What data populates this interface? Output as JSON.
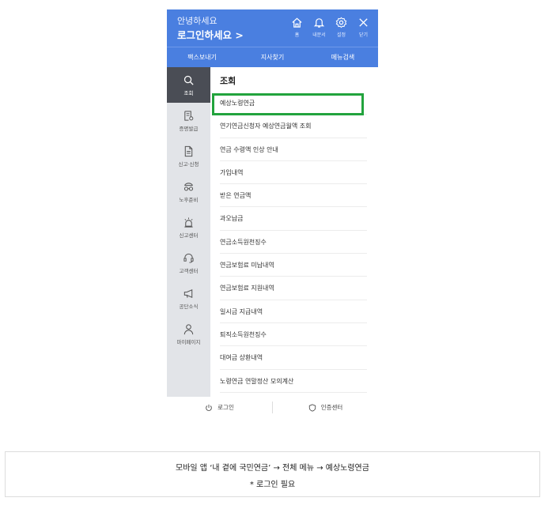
{
  "header": {
    "greeting": "안녕하세요",
    "login_link": "로그인하세요 >",
    "icons": [
      {
        "icon": "home-icon",
        "label": "홈"
      },
      {
        "icon": "bell-icon",
        "label": "내문서"
      },
      {
        "icon": "gear-icon",
        "label": "설정"
      },
      {
        "icon": "close-icon",
        "label": "닫기"
      }
    ]
  },
  "topnav": [
    "팩스보내기",
    "지사찾기",
    "메뉴검색"
  ],
  "sidebar": [
    {
      "icon": "search-icon",
      "label": "조회",
      "active": true
    },
    {
      "icon": "certificate-icon",
      "label": "증명발급"
    },
    {
      "icon": "document-icon",
      "label": "신고·신청"
    },
    {
      "icon": "glasses-icon",
      "label": "노후준비"
    },
    {
      "icon": "siren-icon",
      "label": "신고센터"
    },
    {
      "icon": "headset-icon",
      "label": "고객센터"
    },
    {
      "icon": "megaphone-icon",
      "label": "공단소식"
    },
    {
      "icon": "person-icon",
      "label": "마이페이지"
    }
  ],
  "content": {
    "title": "조회",
    "items": [
      "예상노령연금",
      "연기연금신청자 예상연금월액 조회",
      "연금 수령액 인상 안내",
      "가입내역",
      "받은 연금액",
      "과오납금",
      "연금소득원천징수",
      "연금보험료 미납내역",
      "연금보험료 지원내역",
      "일시금 지급내역",
      "퇴직소득원천징수",
      "대여금 상환내역",
      "노령연금 연말정산 모의계산"
    ]
  },
  "bottombar": {
    "login": "로그인",
    "cert_center": "인증센터"
  },
  "caption": {
    "line1": "모바일 앱 ‘내 곁에 국민연금’ → 전체 메뉴 → 예상노령연금",
    "line2": "* 로그인 필요"
  },
  "colors": {
    "accent": "#4a7fe0",
    "highlight": "#22a33d",
    "sidebar_active": "#4a4d55"
  }
}
